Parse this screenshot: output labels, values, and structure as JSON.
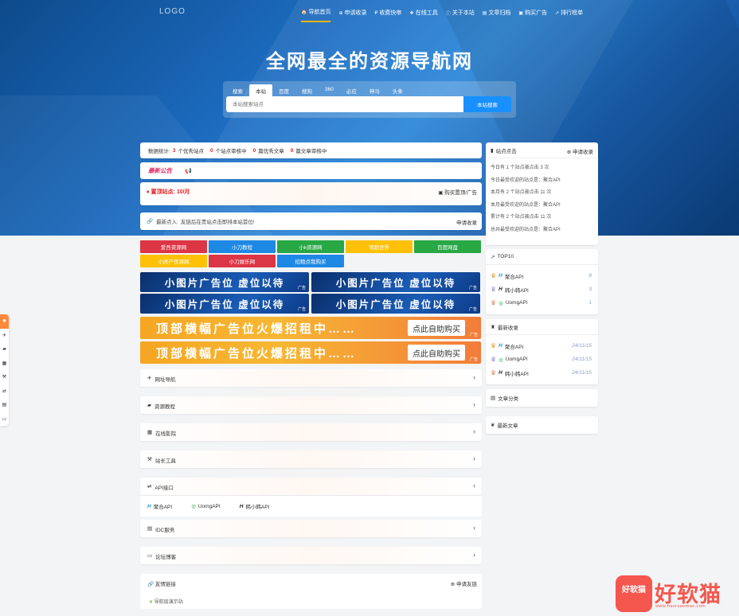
{
  "logo": "LOGO",
  "nav": [
    {
      "icon": "🏠",
      "icon_name": "home-icon",
      "label": "导航首页",
      "active": true
    },
    {
      "icon": "⊕",
      "icon_name": "plus-square-icon",
      "label": "申请收录"
    },
    {
      "icon": "₽",
      "icon_name": "express-icon",
      "label": "收费快审"
    },
    {
      "icon": "❖",
      "icon_name": "tools-icon",
      "label": "在线工具"
    },
    {
      "icon": "ⓘ",
      "icon_name": "info-icon",
      "label": "关于本站"
    },
    {
      "icon": "▤",
      "icon_name": "folder-icon",
      "label": "文章归档"
    },
    {
      "icon": "▣",
      "icon_name": "cart-icon",
      "label": "购买广告"
    },
    {
      "icon": "↗",
      "icon_name": "chart-icon",
      "label": "排行榜单"
    }
  ],
  "hero_title": "全网最全的资源导航网",
  "search": {
    "tabs": [
      "搜索",
      "本站",
      "百度",
      "搜狗",
      "360",
      "必应",
      "神马",
      "头条"
    ],
    "active_tab": 1,
    "placeholder": "本站搜索站点",
    "button": "本站搜索"
  },
  "stats": {
    "prefix": "数据统计:",
    "sites_count": "3",
    "sites_label": "个优秀站点",
    "pending_count": "0",
    "pending_label": "个站点审核中",
    "articles_count": "0",
    "articles_label": "篇优秀文章",
    "articles_pending_count": "0",
    "articles_pending_label": "篇文章审核中"
  },
  "notice": {
    "title": "最新公告",
    "icon_name": "bullhorn-icon"
  },
  "top_sites": {
    "label": "置顶站点:",
    "price": "10/月",
    "buy": "购买置顶/广告"
  },
  "latest": {
    "label": "最新点入:",
    "text": "友链后在贵站点击即排本站首位!",
    "apply": "申请收录"
  },
  "tags": [
    {
      "label": "爱吾资源网",
      "color": "#dc3545"
    },
    {
      "label": "小刀教程",
      "color": "#1e88e5"
    },
    {
      "label": "小k资源网",
      "color": "#28a745"
    },
    {
      "label": "领跑世界",
      "color": "#ffc107"
    },
    {
      "label": "百度网盘",
      "color": "#28a745"
    },
    {
      "label": "小虎产优源网",
      "color": "#ffc107"
    },
    {
      "label": "小刀娱乐网",
      "color": "#dc3545"
    },
    {
      "label": "招租点我购买",
      "color": "#1e88e5"
    }
  ],
  "ads_small": {
    "text": "小图片广告位 虚位以待",
    "mark": "广告"
  },
  "ads_big": {
    "text": "顶部横幅广告位火爆招租中……",
    "button": "点此自助购买",
    "mark": "广告"
  },
  "categories": [
    {
      "icon": "✈",
      "icon_name": "paper-plane-icon",
      "label": "网址导航"
    },
    {
      "icon": "▰",
      "icon_name": "book-icon",
      "label": "资源教程"
    },
    {
      "icon": "▦",
      "icon_name": "film-icon",
      "label": "在线影院"
    },
    {
      "icon": "⚒",
      "icon_name": "hammer-icon",
      "label": "站长工具"
    },
    {
      "icon": "⇄",
      "icon_name": "exchange-icon",
      "label": "API接口"
    },
    {
      "icon": "▤",
      "icon_name": "server-icon",
      "label": "IDC服务"
    },
    {
      "icon": "▭",
      "icon_name": "monitor-icon",
      "label": "论坛博客"
    }
  ],
  "api_links": [
    {
      "icon": "H",
      "label": "聚合API"
    },
    {
      "icon": "◎",
      "label": "UomgAPI"
    },
    {
      "icon": "H",
      "label": "韩小韩API"
    }
  ],
  "friends": {
    "label": "友情链接",
    "apply": "申请友链",
    "link": "导航层演示站"
  },
  "site_clicks": {
    "title": "站点点击",
    "action": "申请收录",
    "lines": [
      "今日有 1 个站点被点击 3 次",
      "今日最受欢迎的站点是：聚合API",
      "本月有 2 个站点被点击 11 次",
      "本月最受欢迎的站点是：聚合API",
      "累计有 2 个站点被点击 11 次",
      "总共最受欢迎的站点是：聚合API"
    ]
  },
  "top10": {
    "title": "TOP10",
    "items": [
      {
        "name": "聚合API",
        "value": "8"
      },
      {
        "name": "韩小韩API",
        "value": "3"
      },
      {
        "name": "UomgAPI",
        "value": "1"
      }
    ]
  },
  "newest": {
    "title": "最新收录",
    "items": [
      {
        "name": "聚合API",
        "date": "24/11/15"
      },
      {
        "name": "UomgAPI",
        "date": "24/11/15"
      },
      {
        "name": "韩小韩API",
        "date": "24/11/15"
      }
    ]
  },
  "article_categories": {
    "title": "文章分类"
  },
  "newest_articles": {
    "title": "最新文章"
  },
  "sidebar_icons": [
    "flame-icon",
    "paper-plane-icon",
    "book-icon",
    "film-icon",
    "hammer-icon",
    "exchange-icon",
    "server-icon",
    "monitor-icon"
  ],
  "watermark": {
    "badge": "好软猫",
    "text": "好软猫",
    "url": "www.haoruanmao.com"
  }
}
